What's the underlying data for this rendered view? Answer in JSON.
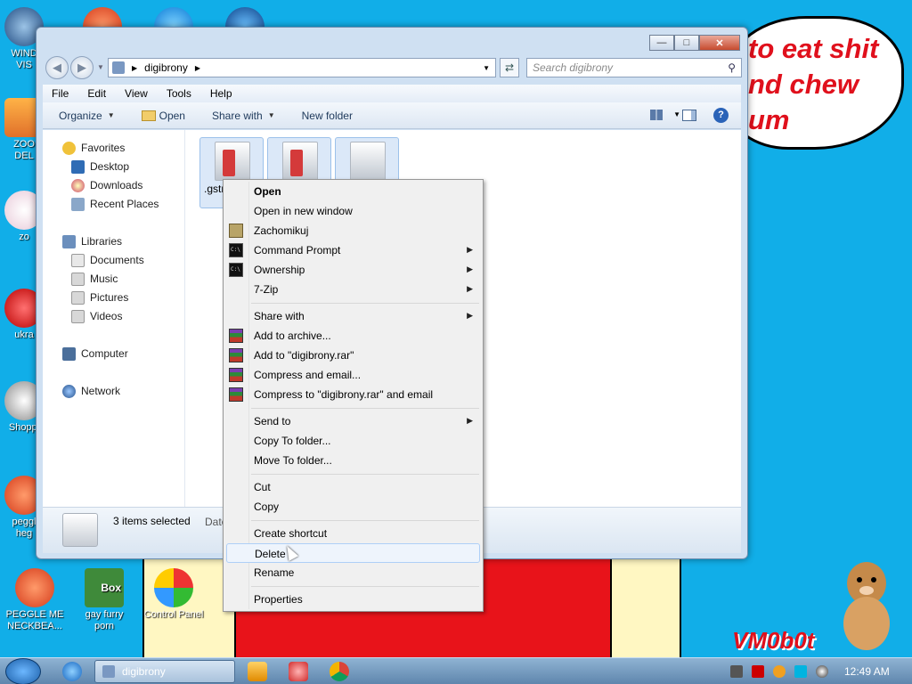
{
  "desktop": {
    "icons": [
      {
        "label": "WIND\nVIS"
      },
      {
        "label": "ZOO\nDEL"
      },
      {
        "label": "zo"
      },
      {
        "label": "ukra"
      },
      {
        "label": "Shoppi"
      },
      {
        "label": "peggl\nheg"
      },
      {
        "label": "PEGGLE ME\nNECKBEA..."
      },
      {
        "label": "gay furry\nporn"
      },
      {
        "label": "Control Panel"
      }
    ],
    "bubble_lines": [
      "to eat shit",
      "nd chew",
      "um"
    ],
    "watermark": "VM0b0t",
    "furry_box_text": "Box"
  },
  "window": {
    "address": {
      "crumb": "digibrony"
    },
    "search": {
      "placeholder": "Search digibrony"
    },
    "menu": [
      "File",
      "Edit",
      "View",
      "Tools",
      "Help"
    ],
    "toolbar": {
      "organize": "Organize",
      "open": "Open",
      "share_with": "Share with",
      "new_folder": "New folder"
    },
    "nav": {
      "favorites": "Favorites",
      "desktop": "Desktop",
      "downloads": "Downloads",
      "recent_places": "Recent Places",
      "libraries": "Libraries",
      "documents": "Documents",
      "music": "Music",
      "pictures": "Pictures",
      "videos": "Videos",
      "computer": "Computer",
      "network": "Network"
    },
    "files": [
      {
        "name": ".gstr"
      },
      {
        "name": ""
      },
      {
        "name": ""
      }
    ],
    "details": {
      "status": "3 items selected",
      "date_label": "Date"
    }
  },
  "context_menu": {
    "items": {
      "open": "Open",
      "open_new_window": "Open in new window",
      "zachomikuj": "Zachomikuj",
      "command_prompt": "Command Prompt",
      "ownership": "Ownership",
      "seven_zip": "7-Zip",
      "share_with": "Share with",
      "add_archive": "Add to archive...",
      "add_rar": "Add to \"digibrony.rar\"",
      "compress_email": "Compress and email...",
      "compress_rar_email": "Compress to \"digibrony.rar\" and email",
      "send_to": "Send to",
      "copy_to_folder": "Copy To folder...",
      "move_to_folder": "Move To folder...",
      "cut": "Cut",
      "copy": "Copy",
      "create_shortcut": "Create shortcut",
      "delete": "Delete",
      "rename": "Rename",
      "properties": "Properties"
    }
  },
  "taskbar": {
    "task_label": "digibrony",
    "clock": "12:49 AM"
  }
}
